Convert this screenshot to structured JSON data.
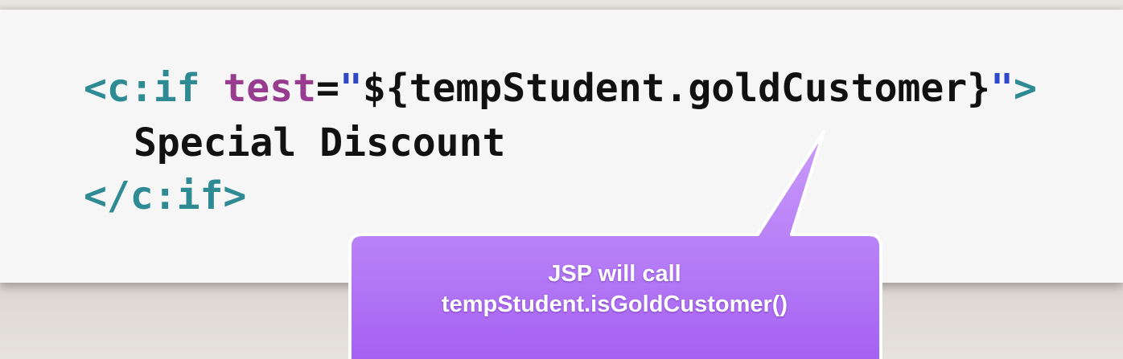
{
  "code": {
    "line1": {
      "open_bracket": "<",
      "tag_name": "c:if",
      "attr_name": "test",
      "equals": "=",
      "open_quote": "\"",
      "expression": "${tempStudent.goldCustomer}",
      "close_quote": "\"",
      "close_bracket": ">"
    },
    "line2": {
      "text": "Special Discount"
    },
    "line3": {
      "close_tag": "</c:if>"
    }
  },
  "callout": {
    "line1": "JSP will call",
    "line2": "tempStudent.isGoldCustomer()"
  },
  "colors": {
    "tag": "#2e8a93",
    "attribute": "#973c8f",
    "quote": "#2f48c9",
    "text": "#111111",
    "callout": "#b67cf7"
  }
}
